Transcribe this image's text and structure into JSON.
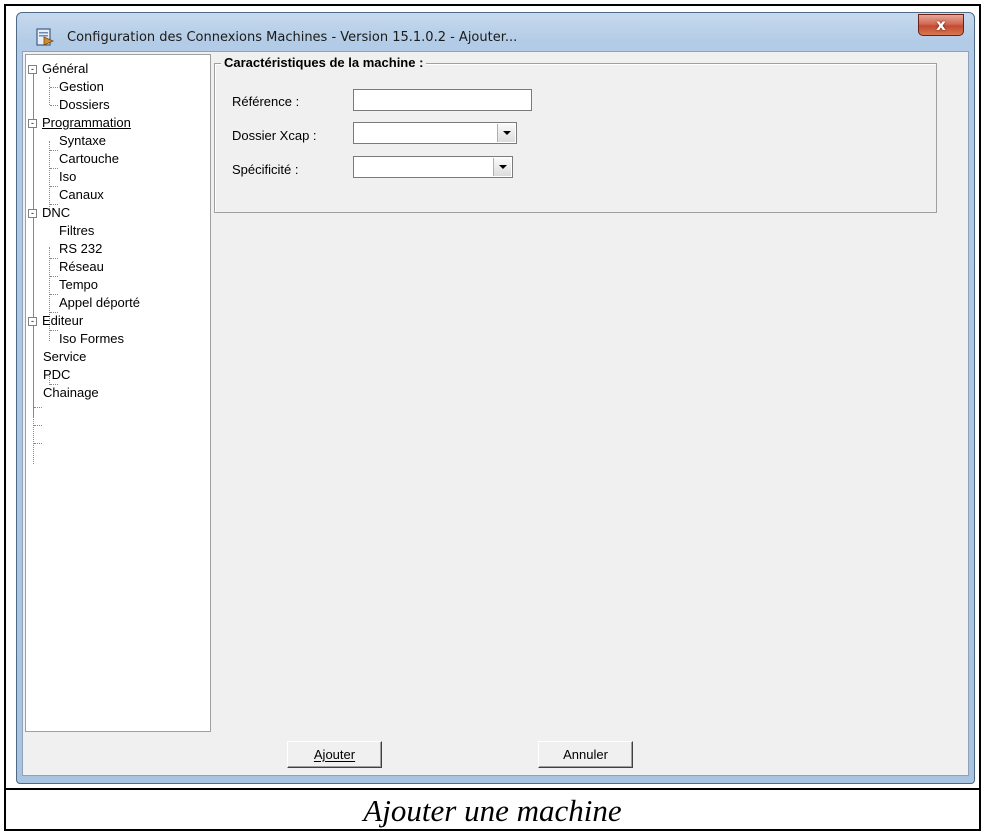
{
  "window": {
    "title": "Configuration des Connexions Machines - Version 15.1.0.2 - Ajouter...",
    "close_label": "x"
  },
  "tree": {
    "items": [
      {
        "label": "Général",
        "level": 0,
        "expander": "-"
      },
      {
        "label": "Gestion",
        "level": 1
      },
      {
        "label": "Dossiers",
        "level": 1
      },
      {
        "label": "Programmation",
        "level": 0,
        "expander": "-",
        "selected": true
      },
      {
        "label": "Syntaxe",
        "level": 1
      },
      {
        "label": "Cartouche",
        "level": 1
      },
      {
        "label": "Iso",
        "level": 1
      },
      {
        "label": "Canaux",
        "level": 1
      },
      {
        "label": "DNC",
        "level": 0,
        "expander": "-"
      },
      {
        "label": "Filtres",
        "level": 1
      },
      {
        "label": "RS 232",
        "level": 1
      },
      {
        "label": "Réseau",
        "level": 1
      },
      {
        "label": "Tempo",
        "level": 1
      },
      {
        "label": "Appel déporté",
        "level": 1
      },
      {
        "label": "Editeur",
        "level": 0,
        "expander": "-"
      },
      {
        "label": "Iso Formes",
        "level": 1
      },
      {
        "label": "Service",
        "level": 0
      },
      {
        "label": "PDC",
        "level": 0
      },
      {
        "label": "Chainage",
        "level": 0
      }
    ]
  },
  "machine": {
    "group_title": "Caractéristiques de la machine :",
    "reference_label": "Référence :",
    "reference_value": "",
    "dossier_label": "Dossier Xcap :",
    "dossier_value": "",
    "specificite_label": "Spécificité :",
    "specificite_value": ""
  },
  "buttons": {
    "add_label": "Ajouter",
    "cancel_label": "Annuler"
  },
  "caption": "Ajouter une machine"
}
